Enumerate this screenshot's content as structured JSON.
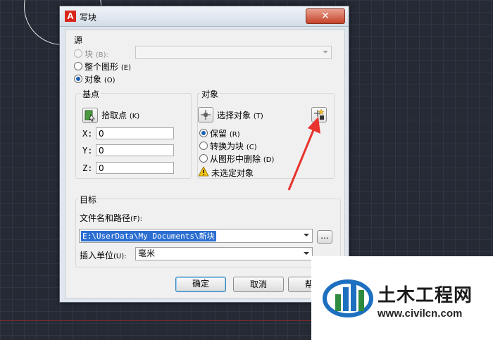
{
  "dialog": {
    "title": "写块"
  },
  "source": {
    "label": "源",
    "options": [
      {
        "label": "块",
        "hotkey": "(B):"
      },
      {
        "label": "整个图形",
        "hotkey": "(E)"
      },
      {
        "label": "对象",
        "hotkey": "(O)"
      }
    ]
  },
  "basepoint": {
    "label": "基点",
    "pick_label": "拾取点",
    "pick_hotkey": "(K)",
    "x_label": "X:",
    "x_value": "0",
    "y_label": "Y:",
    "y_value": "0",
    "z_label": "Z:",
    "z_value": "0"
  },
  "objects": {
    "label": "对象",
    "select_label": "选择对象",
    "select_hotkey": "(T)",
    "options": [
      {
        "label": "保留",
        "hotkey": "(R)"
      },
      {
        "label": "转换为块",
        "hotkey": "(C)"
      },
      {
        "label": "从图形中删除",
        "hotkey": "(D)"
      }
    ],
    "warning": "未选定对象"
  },
  "destination": {
    "label": "目标",
    "path_label": "文件名和路径",
    "path_hotkey": "(F):",
    "path_value": "E:\\UserData\\My Documents\\新块",
    "browse_label": "...",
    "units_label": "插入单位",
    "units_hotkey": "(U):",
    "units_value": "毫米"
  },
  "buttons": {
    "ok": "确定",
    "cancel": "取消",
    "help": "帮助"
  },
  "watermark": {
    "title": "土木工程网",
    "url": "www.civilcn.com"
  },
  "colors": {
    "accent": "#2c6fd1",
    "arrow": "#e8322c",
    "close": "#c7432b"
  }
}
